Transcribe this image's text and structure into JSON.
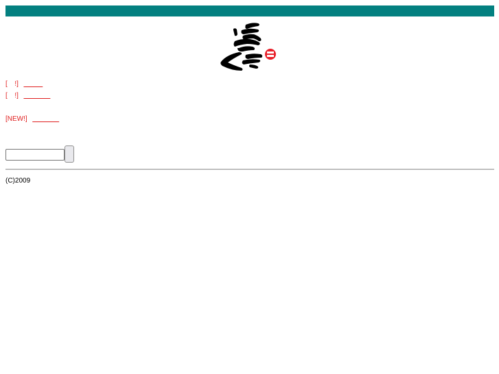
{
  "news": {
    "item1": {
      "prefix": "[",
      "mark": "!]",
      "link_text": "          "
    },
    "item2": {
      "prefix": "[",
      "mark": "!]",
      "link_text": "              "
    },
    "item3": {
      "prefix": "[NEW!]",
      "link_text": "              "
    }
  },
  "search": {
    "value": "",
    "placeholder": ""
  },
  "footer": {
    "copyright": "(C)2009"
  },
  "colors": {
    "top_bar": "#038080",
    "link": "#e02020",
    "logo_badge": "#e8202a"
  },
  "icons": {
    "logo": "calligraphy-logo-icon",
    "badge": "speech-bubble-icon"
  }
}
